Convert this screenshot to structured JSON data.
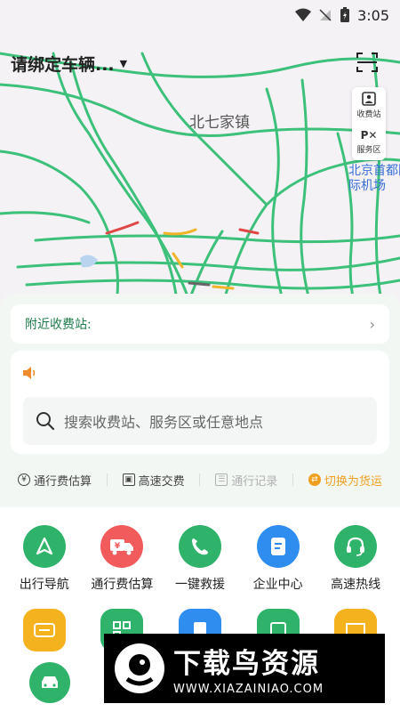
{
  "status_bar": {
    "time": "3:05"
  },
  "map": {
    "vehicle_label": "请绑定车辆...",
    "town_label": "北七家镇",
    "airport_label": "北京首都国际机场",
    "tools": [
      {
        "label": "收费站",
        "icon": "toll-station-icon"
      },
      {
        "label": "服务区",
        "icon": "service-area-icon",
        "glyph": "P✕"
      }
    ]
  },
  "nearby": {
    "label": "附近收费站:"
  },
  "search": {
    "placeholder": "搜索收费站、服务区或任意地点"
  },
  "quick_actions": [
    {
      "label": "通行费估算",
      "icon": "¥"
    },
    {
      "label": "高速交费",
      "icon": "▣"
    },
    {
      "label": "通行记录",
      "icon": "☰"
    },
    {
      "label": "切换为货运",
      "icon": "⇄"
    }
  ],
  "services": [
    {
      "label": "出行导航",
      "color": "#2fb36b",
      "icon": "navigation-icon"
    },
    {
      "label": "通行费估算",
      "color": "#f25b5b",
      "icon": "truck-fee-icon"
    },
    {
      "label": "一键救援",
      "color": "#2fb36b",
      "icon": "phone-icon"
    },
    {
      "label": "企业中心",
      "color": "#2f8df0",
      "icon": "document-icon"
    },
    {
      "label": "高速热线",
      "color": "#2fb36b",
      "icon": "headset-icon"
    }
  ],
  "services_row2": [
    {
      "color": "#f5b21f"
    },
    {
      "color": "#2fb36b"
    },
    {
      "color": "#2f8df0"
    },
    {
      "color": "#2fb36b"
    },
    {
      "color": "#f5b21f"
    }
  ],
  "watermark": {
    "title": "下载鸟资源",
    "url": "WWW.XIAZAINIAO.COM"
  },
  "colors": {
    "accent_green": "#2fb36b",
    "accent_orange": "#f0a020",
    "road_green": "#3cc07a"
  }
}
